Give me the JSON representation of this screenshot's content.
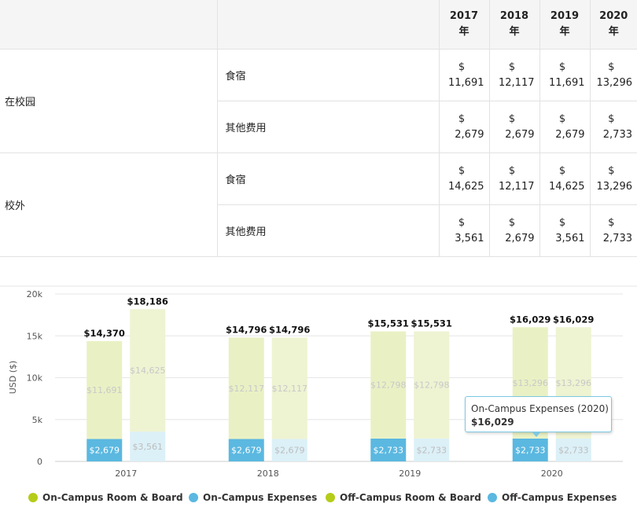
{
  "table": {
    "years": [
      {
        "year": "2017",
        "suffix": "年"
      },
      {
        "year": "2018",
        "suffix": "年"
      },
      {
        "year": "2019",
        "suffix": "年"
      },
      {
        "year": "2020",
        "suffix": "年"
      }
    ],
    "groups": [
      {
        "label": "在校园",
        "rows": [
          {
            "label": "食宿",
            "values": [
              "11,691",
              "12,117",
              "11,691",
              "13,296"
            ]
          },
          {
            "label": "其他费用",
            "values": [
              "2,679",
              "2,679",
              "2,679",
              "2,733"
            ]
          }
        ]
      },
      {
        "label": "校外",
        "rows": [
          {
            "label": "食宿",
            "values": [
              "14,625",
              "12,117",
              "14,625",
              "13,296"
            ]
          },
          {
            "label": "其他费用",
            "values": [
              "3,561",
              "2,679",
              "3,561",
              "2,733"
            ]
          }
        ]
      }
    ],
    "currency": "$"
  },
  "chart_data": {
    "type": "bar",
    "stacked": true,
    "categories": [
      "2017",
      "2018",
      "2019",
      "2020"
    ],
    "ylabel": "USD ($)",
    "ylim": [
      0,
      20000
    ],
    "yticks": [
      "0",
      "5k",
      "10k",
      "15k",
      "20k"
    ],
    "grid": true,
    "legend_position": "bottom",
    "stacks": [
      {
        "name": "On-Campus",
        "totals": [
          "$14,370",
          "$14,796",
          "$15,531",
          "$16,029"
        ],
        "series": [
          {
            "name": "On-Campus Expenses",
            "values": [
              2679,
              2679,
              2733,
              2733
            ],
            "labels": [
              "$2,679",
              "$2,679",
              "$2,733",
              "$2,733"
            ],
            "color": "#5bb8e0"
          },
          {
            "name": "On-Campus Room & Board",
            "values": [
              11691,
              12117,
              12798,
              13296
            ],
            "labels": [
              "$11,691",
              "$12,117",
              "$12,798",
              "$13,296"
            ],
            "color": "#e9f1c4"
          }
        ]
      },
      {
        "name": "Off-Campus",
        "totals": [
          "$18,186",
          "$14,796",
          "$15,531",
          "$16,029"
        ],
        "series": [
          {
            "name": "Off-Campus Expenses",
            "values": [
              3561,
              2679,
              2733,
              2733
            ],
            "labels": [
              "$3,561",
              "$2,679",
              "$2,733",
              "$2,733"
            ],
            "color": "#dcf0f7"
          },
          {
            "name": "Off-Campus Room & Board",
            "values": [
              14625,
              12117,
              12798,
              13296
            ],
            "labels": [
              "$14,625",
              "$12,117",
              "$12,798",
              "$13,296"
            ],
            "color": "#eef3d2"
          }
        ]
      }
    ],
    "legend": [
      {
        "label": "On-Campus Room & Board",
        "color": "#b5cc18"
      },
      {
        "label": "On-Campus Expenses",
        "color": "#5bb8e0"
      },
      {
        "label": "Off-Campus Room & Board",
        "color": "#b5cc18"
      },
      {
        "label": "Off-Campus Expenses",
        "color": "#5bb8e0"
      }
    ],
    "tooltip": {
      "title": "On-Campus Expenses (2020)",
      "value": "$16,029"
    }
  }
}
